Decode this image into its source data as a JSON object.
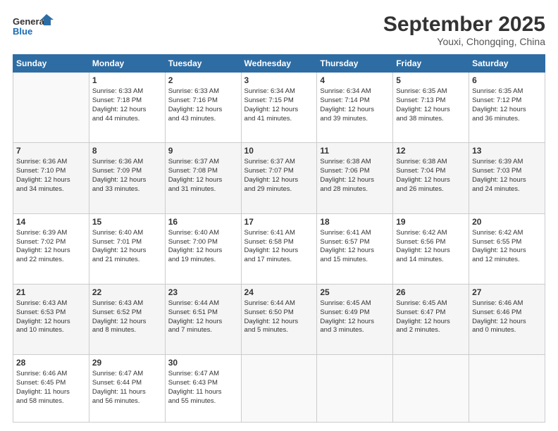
{
  "logo": {
    "line1": "General",
    "line2": "Blue"
  },
  "title": "September 2025",
  "location": "Youxi, Chongqing, China",
  "weekdays": [
    "Sunday",
    "Monday",
    "Tuesday",
    "Wednesday",
    "Thursday",
    "Friday",
    "Saturday"
  ],
  "weeks": [
    [
      {
        "day": "",
        "info": ""
      },
      {
        "day": "1",
        "info": "Sunrise: 6:33 AM\nSunset: 7:18 PM\nDaylight: 12 hours\nand 44 minutes."
      },
      {
        "day": "2",
        "info": "Sunrise: 6:33 AM\nSunset: 7:16 PM\nDaylight: 12 hours\nand 43 minutes."
      },
      {
        "day": "3",
        "info": "Sunrise: 6:34 AM\nSunset: 7:15 PM\nDaylight: 12 hours\nand 41 minutes."
      },
      {
        "day": "4",
        "info": "Sunrise: 6:34 AM\nSunset: 7:14 PM\nDaylight: 12 hours\nand 39 minutes."
      },
      {
        "day": "5",
        "info": "Sunrise: 6:35 AM\nSunset: 7:13 PM\nDaylight: 12 hours\nand 38 minutes."
      },
      {
        "day": "6",
        "info": "Sunrise: 6:35 AM\nSunset: 7:12 PM\nDaylight: 12 hours\nand 36 minutes."
      }
    ],
    [
      {
        "day": "7",
        "info": "Sunrise: 6:36 AM\nSunset: 7:10 PM\nDaylight: 12 hours\nand 34 minutes."
      },
      {
        "day": "8",
        "info": "Sunrise: 6:36 AM\nSunset: 7:09 PM\nDaylight: 12 hours\nand 33 minutes."
      },
      {
        "day": "9",
        "info": "Sunrise: 6:37 AM\nSunset: 7:08 PM\nDaylight: 12 hours\nand 31 minutes."
      },
      {
        "day": "10",
        "info": "Sunrise: 6:37 AM\nSunset: 7:07 PM\nDaylight: 12 hours\nand 29 minutes."
      },
      {
        "day": "11",
        "info": "Sunrise: 6:38 AM\nSunset: 7:06 PM\nDaylight: 12 hours\nand 28 minutes."
      },
      {
        "day": "12",
        "info": "Sunrise: 6:38 AM\nSunset: 7:04 PM\nDaylight: 12 hours\nand 26 minutes."
      },
      {
        "day": "13",
        "info": "Sunrise: 6:39 AM\nSunset: 7:03 PM\nDaylight: 12 hours\nand 24 minutes."
      }
    ],
    [
      {
        "day": "14",
        "info": "Sunrise: 6:39 AM\nSunset: 7:02 PM\nDaylight: 12 hours\nand 22 minutes."
      },
      {
        "day": "15",
        "info": "Sunrise: 6:40 AM\nSunset: 7:01 PM\nDaylight: 12 hours\nand 21 minutes."
      },
      {
        "day": "16",
        "info": "Sunrise: 6:40 AM\nSunset: 7:00 PM\nDaylight: 12 hours\nand 19 minutes."
      },
      {
        "day": "17",
        "info": "Sunrise: 6:41 AM\nSunset: 6:58 PM\nDaylight: 12 hours\nand 17 minutes."
      },
      {
        "day": "18",
        "info": "Sunrise: 6:41 AM\nSunset: 6:57 PM\nDaylight: 12 hours\nand 15 minutes."
      },
      {
        "day": "19",
        "info": "Sunrise: 6:42 AM\nSunset: 6:56 PM\nDaylight: 12 hours\nand 14 minutes."
      },
      {
        "day": "20",
        "info": "Sunrise: 6:42 AM\nSunset: 6:55 PM\nDaylight: 12 hours\nand 12 minutes."
      }
    ],
    [
      {
        "day": "21",
        "info": "Sunrise: 6:43 AM\nSunset: 6:53 PM\nDaylight: 12 hours\nand 10 minutes."
      },
      {
        "day": "22",
        "info": "Sunrise: 6:43 AM\nSunset: 6:52 PM\nDaylight: 12 hours\nand 8 minutes."
      },
      {
        "day": "23",
        "info": "Sunrise: 6:44 AM\nSunset: 6:51 PM\nDaylight: 12 hours\nand 7 minutes."
      },
      {
        "day": "24",
        "info": "Sunrise: 6:44 AM\nSunset: 6:50 PM\nDaylight: 12 hours\nand 5 minutes."
      },
      {
        "day": "25",
        "info": "Sunrise: 6:45 AM\nSunset: 6:49 PM\nDaylight: 12 hours\nand 3 minutes."
      },
      {
        "day": "26",
        "info": "Sunrise: 6:45 AM\nSunset: 6:47 PM\nDaylight: 12 hours\nand 2 minutes."
      },
      {
        "day": "27",
        "info": "Sunrise: 6:46 AM\nSunset: 6:46 PM\nDaylight: 12 hours\nand 0 minutes."
      }
    ],
    [
      {
        "day": "28",
        "info": "Sunrise: 6:46 AM\nSunset: 6:45 PM\nDaylight: 11 hours\nand 58 minutes."
      },
      {
        "day": "29",
        "info": "Sunrise: 6:47 AM\nSunset: 6:44 PM\nDaylight: 11 hours\nand 56 minutes."
      },
      {
        "day": "30",
        "info": "Sunrise: 6:47 AM\nSunset: 6:43 PM\nDaylight: 11 hours\nand 55 minutes."
      },
      {
        "day": "",
        "info": ""
      },
      {
        "day": "",
        "info": ""
      },
      {
        "day": "",
        "info": ""
      },
      {
        "day": "",
        "info": ""
      }
    ]
  ]
}
